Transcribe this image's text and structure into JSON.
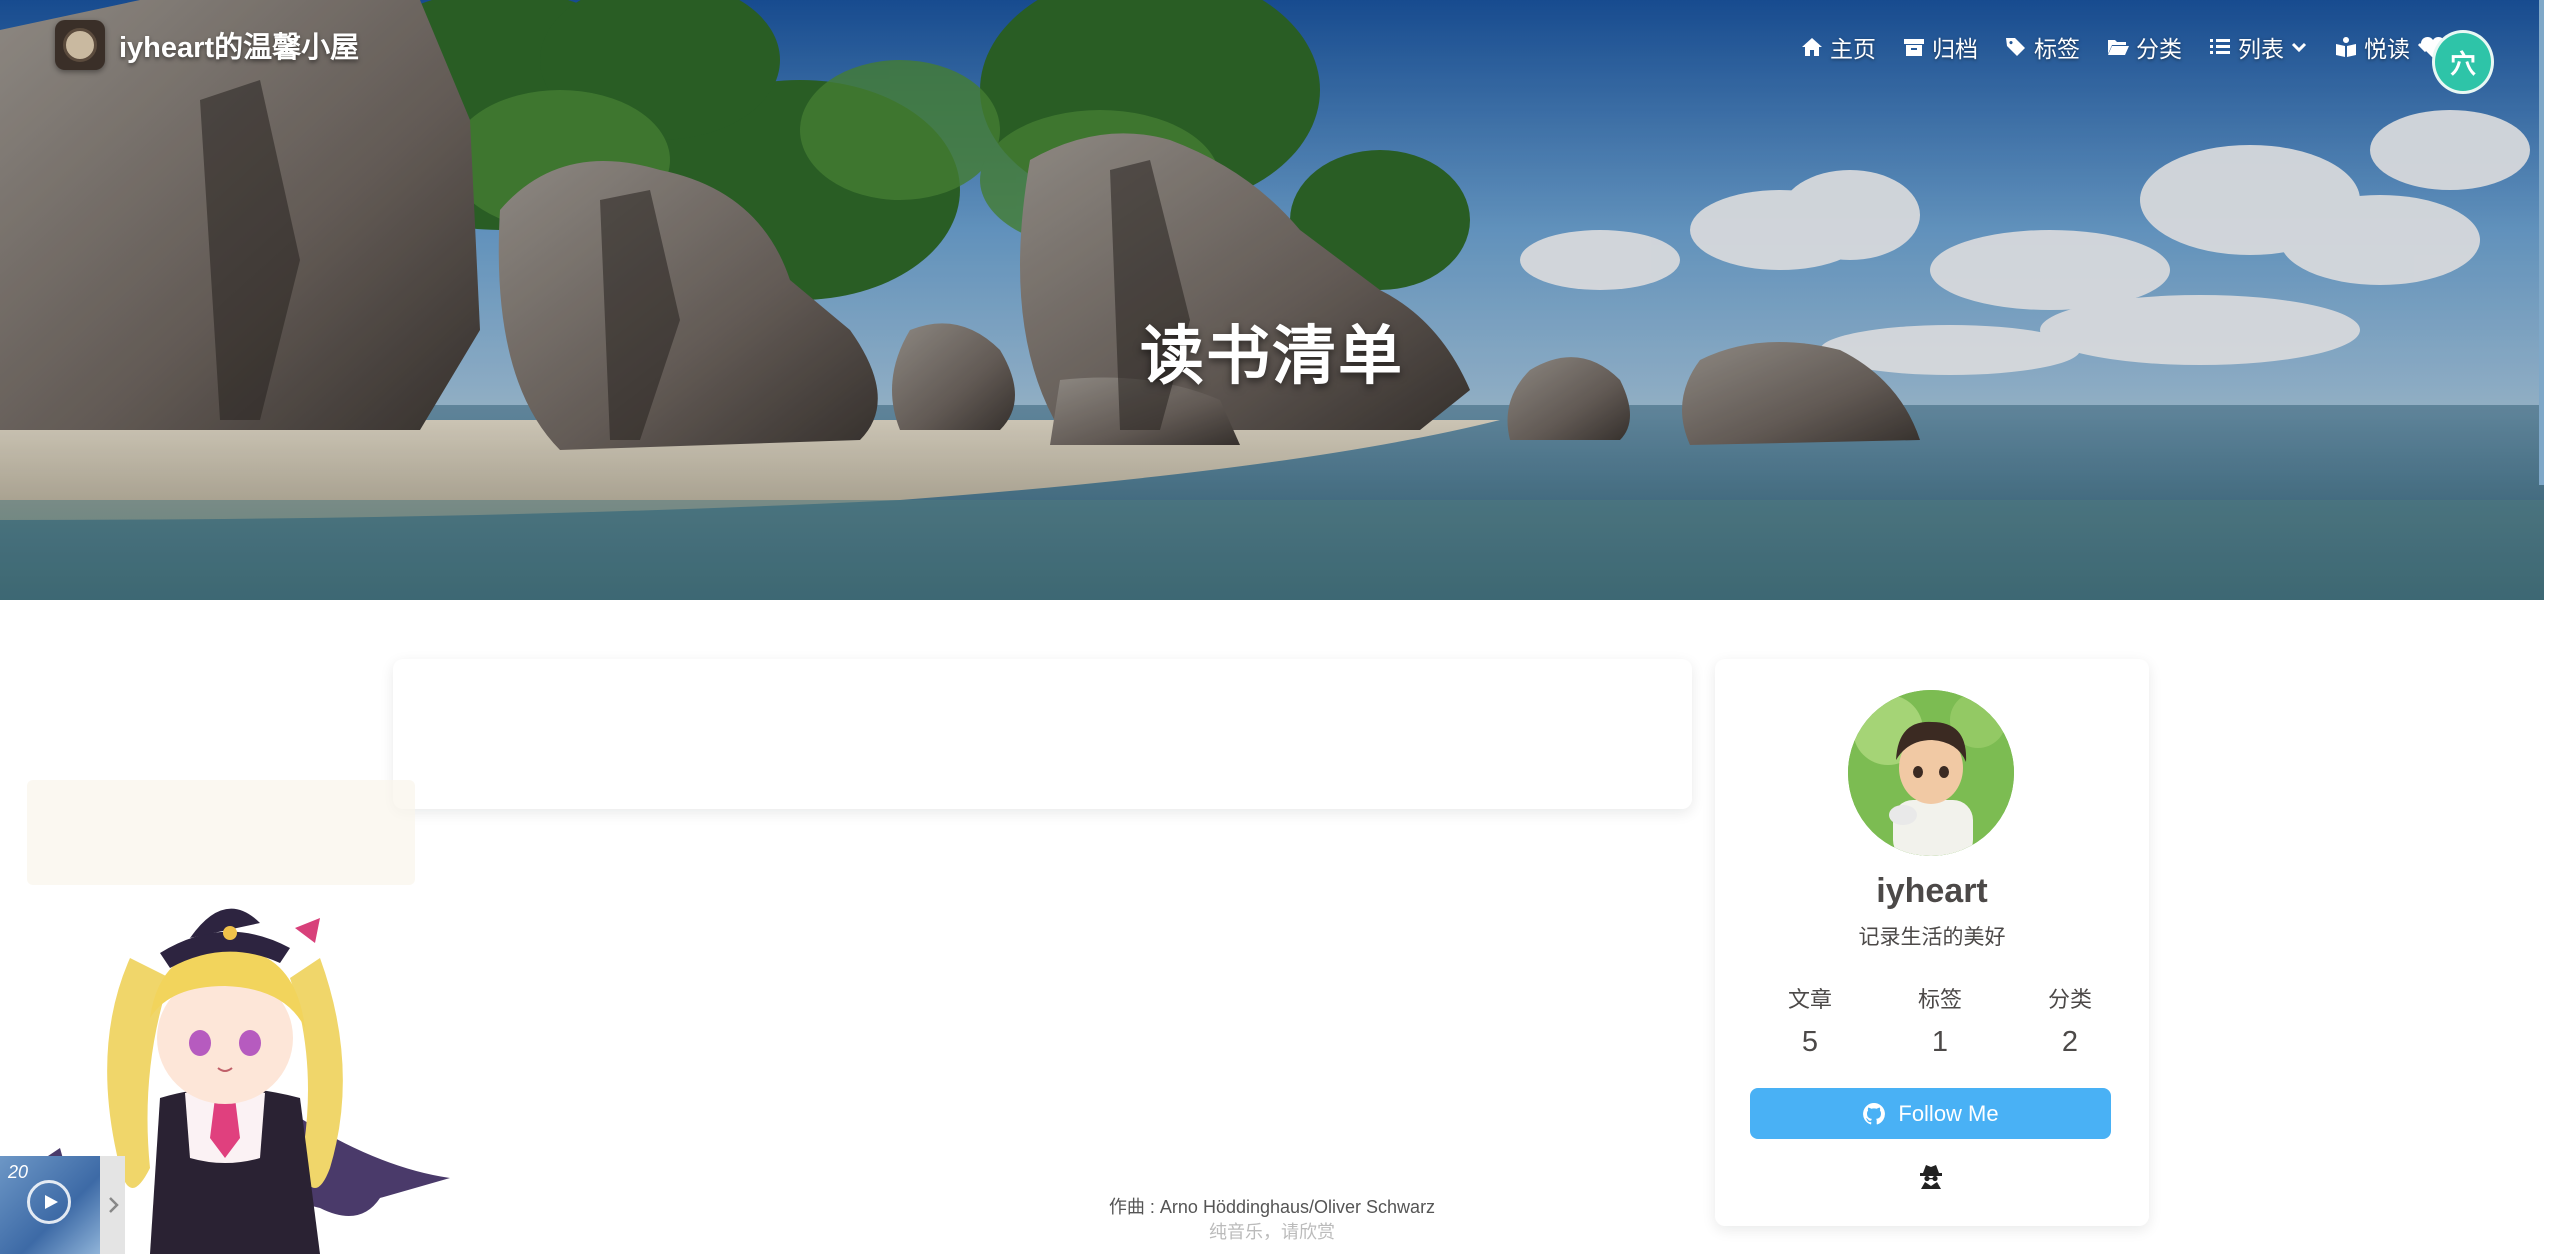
{
  "site": {
    "title": "iyheart的温馨小屋"
  },
  "nav": {
    "items": [
      {
        "label": "主页",
        "icon": "home-icon"
      },
      {
        "label": "归档",
        "icon": "archive-icon"
      },
      {
        "label": "标签",
        "icon": "tags-icon"
      },
      {
        "label": "分类",
        "icon": "folder-open-icon"
      },
      {
        "label": "列表",
        "icon": "list-icon",
        "dropdown": true
      },
      {
        "label": "悦读",
        "icon": "book-reader-icon",
        "dropdown": true
      }
    ]
  },
  "page": {
    "title": "读书清单"
  },
  "profile": {
    "name": "iyheart",
    "description": "记录生活的美好",
    "stats": [
      {
        "label": "文章",
        "value": "5"
      },
      {
        "label": "标签",
        "value": "1"
      },
      {
        "label": "分类",
        "value": "2"
      }
    ],
    "follow_label": "Follow Me"
  },
  "music": {
    "lyric": "作曲 : Arno Höddinghaus/Oliver Schwarz",
    "sub": "纯音乐，请欣赏",
    "cover_text": "20"
  },
  "colors": {
    "accent": "#49b1f5",
    "text": "#4c4948"
  }
}
